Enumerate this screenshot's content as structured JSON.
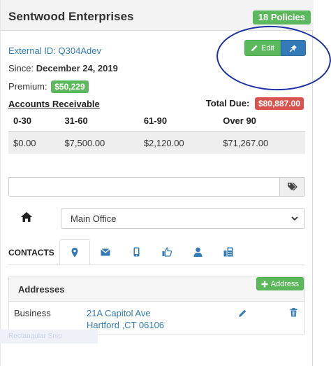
{
  "header": {
    "title": "Sentwood Enterprises",
    "policies_badge": "18 Policies"
  },
  "info": {
    "external_id": "External ID: Q304Adev",
    "since_label": "Since:",
    "since_value": "December 24, 2019",
    "premium_label": "Premium:",
    "premium_value": "$50,229"
  },
  "actions": {
    "edit_label": "Edit"
  },
  "accounts_receivable": {
    "title": "Accounts Receivable",
    "total_due_label": "Total Due:",
    "total_due_value": "$80,887.00",
    "columns": [
      "0-30",
      "31-60",
      "61-90",
      "Over 90"
    ],
    "values": [
      "$0.00",
      "$7,500.00",
      "$2,120.00",
      "$71,267.00"
    ]
  },
  "tags": {
    "placeholder": ""
  },
  "office": {
    "selected": "Main Office"
  },
  "contacts": {
    "label": "CONTACTS"
  },
  "addresses": {
    "title": "Addresses",
    "add_label": "Address",
    "items": [
      {
        "type": "Business",
        "line1": "21A Capitol Ave",
        "line2": "Hartford ,CT 06106"
      }
    ]
  },
  "overlay": {
    "ghost_text": "Rectangular Snip"
  },
  "colors": {
    "green": "#5cb85c",
    "blue": "#337ab7",
    "red": "#d9534f",
    "annotation": "#1c2fa3"
  }
}
